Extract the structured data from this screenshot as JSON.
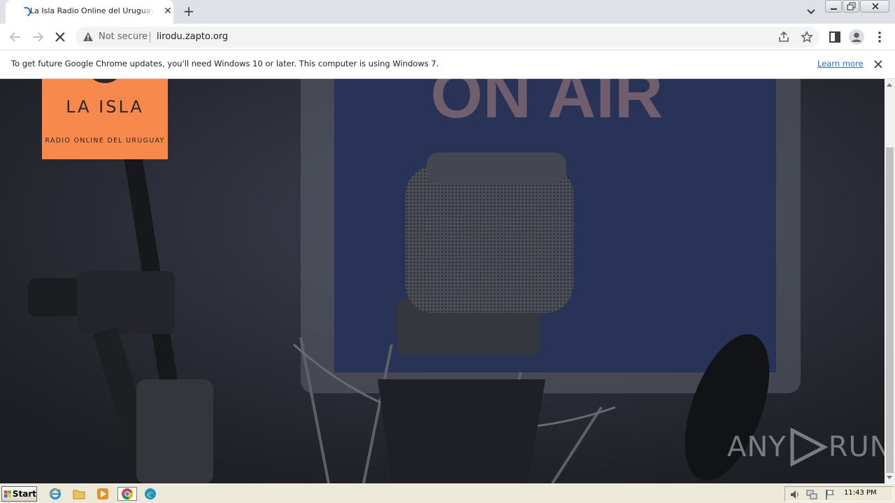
{
  "browser": {
    "tab": {
      "title": "La Isla Radio Online del Uruguay - LIR",
      "close": "✕"
    },
    "new_tab": "+",
    "address": {
      "security_label": "Not secure",
      "url": "lirodu.zapto.org"
    }
  },
  "infobar": {
    "message": "To get future Google Chrome updates, you'll need Windows 10 or later. This computer is using Windows 7.",
    "link": "Learn more"
  },
  "page": {
    "logo": {
      "title": "LA ISLA",
      "subtitle": "RADIO ONLINE DEL URUGUAY"
    },
    "hero_sign": "ON AIR"
  },
  "watermark": {
    "part1": "ANY",
    "part2": "RUN"
  },
  "taskbar": {
    "start_label": "Start",
    "apps": [
      "internet-explorer-icon",
      "folder-icon",
      "media-player-icon",
      "chrome-icon",
      "edge-icon"
    ],
    "clock": "11:43 PM"
  },
  "colors": {
    "accent": "#1a73e8",
    "logo_bg": "#f6894b",
    "logo_text": "#2d2623",
    "page_bg": "#2b2e34"
  }
}
